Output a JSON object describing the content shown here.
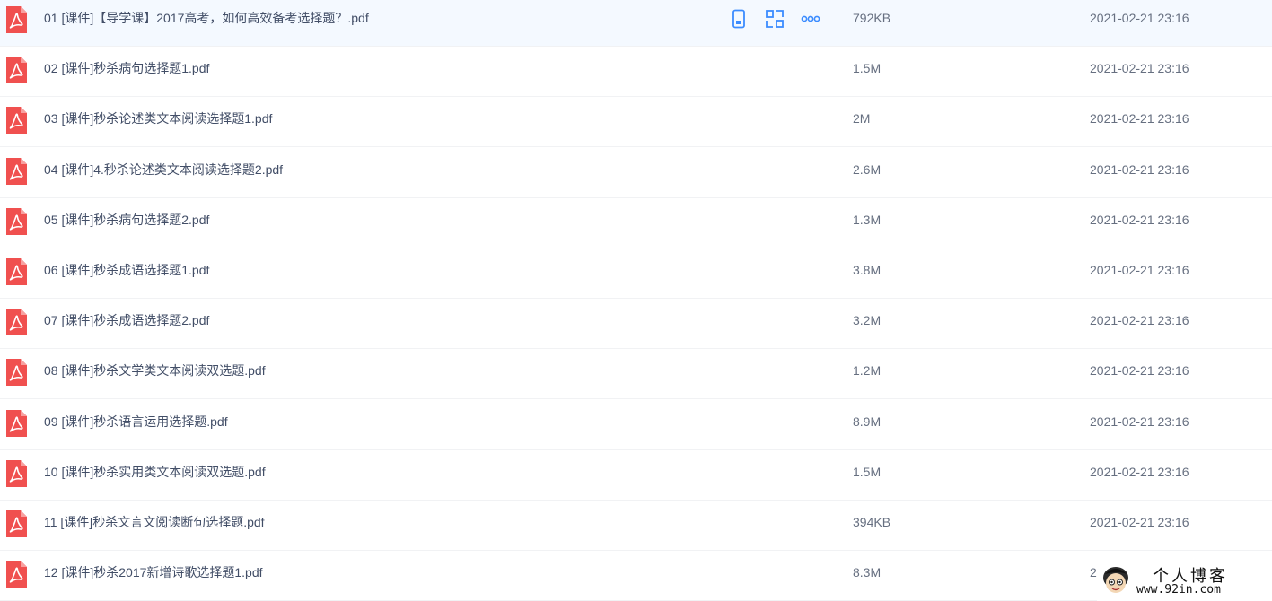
{
  "files": [
    {
      "name": "01 [课件]【导学课】2017高考，如何高效备考选择题？.pdf",
      "size": "792KB",
      "modified": "2021-02-21 23:16",
      "selected": true
    },
    {
      "name": "02 [课件]秒杀病句选择题1.pdf",
      "size": "1.5M",
      "modified": "2021-02-21 23:16"
    },
    {
      "name": "03 [课件]秒杀论述类文本阅读选择题1.pdf",
      "size": "2M",
      "modified": "2021-02-21 23:16"
    },
    {
      "name": "04 [课件]4.秒杀论述类文本阅读选择题2.pdf",
      "size": "2.6M",
      "modified": "2021-02-21 23:16"
    },
    {
      "name": "05 [课件]秒杀病句选择题2.pdf",
      "size": "1.3M",
      "modified": "2021-02-21 23:16"
    },
    {
      "name": "06 [课件]秒杀成语选择题1.pdf",
      "size": "3.8M",
      "modified": "2021-02-21 23:16"
    },
    {
      "name": "07 [课件]秒杀成语选择题2.pdf",
      "size": "3.2M",
      "modified": "2021-02-21 23:16"
    },
    {
      "name": "08 [课件]秒杀文学类文本阅读双选题.pdf",
      "size": "1.2M",
      "modified": "2021-02-21 23:16"
    },
    {
      "name": "09 [课件]秒杀语言运用选择题.pdf",
      "size": "8.9M",
      "modified": "2021-02-21 23:16"
    },
    {
      "name": "10 [课件]秒杀实用类文本阅读双选题.pdf",
      "size": "1.5M",
      "modified": "2021-02-21 23:16"
    },
    {
      "name": "11 [课件]秒杀文言文阅读断句选择题.pdf",
      "size": "394KB",
      "modified": "2021-02-21 23:16"
    },
    {
      "name": "12 [课件]秒杀2017新增诗歌选择题1.pdf",
      "size": "8.3M",
      "modified": "2"
    }
  ],
  "row_actions": [
    "phone-icon",
    "share-icon",
    "more-icon"
  ],
  "icons": {
    "file_type": "pdf-icon"
  },
  "watermark": {
    "title": "个人博客",
    "url": "www.92in.com"
  },
  "colors": {
    "selected_row_bg": "#f4f9ff",
    "pdf_icon": "#f0504f",
    "action_icon": "#3b8cff",
    "name_text": "#424e67",
    "meta_text": "#666f80"
  }
}
